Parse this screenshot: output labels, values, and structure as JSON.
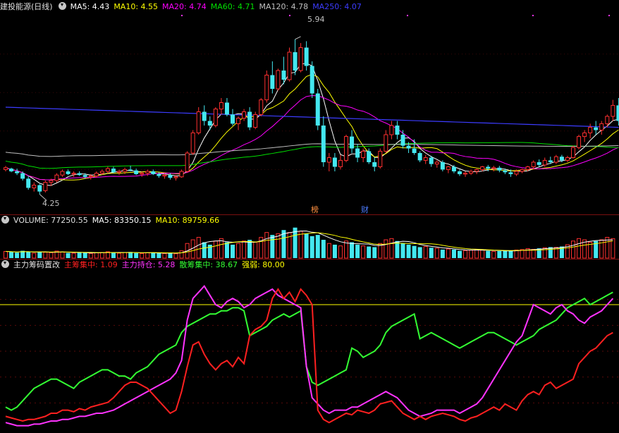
{
  "main": {
    "title": "建投能源(日线)",
    "indicators": [
      {
        "label": "MA5: 4.43",
        "color": "#ffffff"
      },
      {
        "label": "MA10: 4.55",
        "color": "#ffff00"
      },
      {
        "label": "MA20: 4.74",
        "color": "#ff00ff"
      },
      {
        "label": "MA60: 4.71",
        "color": "#00e000"
      },
      {
        "label": "MA120: 4.78",
        "color": "#c0c0c0"
      },
      {
        "label": "MA250: 4.07",
        "color": "#3c3cff"
      }
    ],
    "high_label": "5.94",
    "low_label": "4.25",
    "markers": [
      "榜",
      "财"
    ]
  },
  "volume": {
    "title": "VOLUME: 77250.55",
    "ma5": "MA5: 83350.15",
    "ma10": "MA10: 89759.66"
  },
  "indicator": {
    "title": "主力筹码置改",
    "items": [
      {
        "label": "主筹集中: 1.09",
        "color": "#ff2020"
      },
      {
        "label": "主力持仓: 5.28",
        "color": "#ff33ff"
      },
      {
        "label": "散筹集中: 38.67",
        "color": "#33ff33"
      },
      {
        "label": "强弱: 80.00",
        "color": "#ffff00"
      }
    ]
  },
  "colors": {
    "up": "#ff3030",
    "down": "#44e8f0",
    "bg": "#000000",
    "grid": "#7a1010"
  },
  "chart_data": [
    {
      "type": "candlestick",
      "ylim": [
        4.1,
        6.2
      ],
      "annotations": {
        "high": 5.94,
        "low": 4.25
      },
      "ohlc": [
        [
          4.52,
          4.56,
          4.5,
          4.54
        ],
        [
          4.53,
          4.54,
          4.49,
          4.5
        ],
        [
          4.5,
          4.53,
          4.46,
          4.48
        ],
        [
          4.48,
          4.5,
          4.4,
          4.42
        ],
        [
          4.42,
          4.45,
          4.3,
          4.32
        ],
        [
          4.32,
          4.38,
          4.28,
          4.35
        ],
        [
          4.35,
          4.36,
          4.25,
          4.28
        ],
        [
          4.29,
          4.4,
          4.27,
          4.38
        ],
        [
          4.38,
          4.42,
          4.34,
          4.4
        ],
        [
          4.4,
          4.48,
          4.38,
          4.46
        ],
        [
          4.46,
          4.52,
          4.44,
          4.5
        ],
        [
          4.5,
          4.52,
          4.46,
          4.47
        ],
        [
          4.47,
          4.5,
          4.44,
          4.48
        ],
        [
          4.48,
          4.5,
          4.45,
          4.46
        ],
        [
          4.46,
          4.48,
          4.42,
          4.44
        ],
        [
          4.44,
          4.47,
          4.41,
          4.45
        ],
        [
          4.45,
          4.5,
          4.43,
          4.48
        ],
        [
          4.48,
          4.52,
          4.46,
          4.5
        ],
        [
          4.5,
          4.55,
          4.48,
          4.53
        ],
        [
          4.53,
          4.55,
          4.48,
          4.49
        ],
        [
          4.49,
          4.52,
          4.46,
          4.5
        ],
        [
          4.5,
          4.54,
          4.47,
          4.52
        ],
        [
          4.52,
          4.56,
          4.5,
          4.51
        ],
        [
          4.51,
          4.53,
          4.46,
          4.47
        ],
        [
          4.47,
          4.5,
          4.44,
          4.48
        ],
        [
          4.48,
          4.52,
          4.45,
          4.5
        ],
        [
          4.5,
          4.52,
          4.46,
          4.47
        ],
        [
          4.47,
          4.49,
          4.43,
          4.45
        ],
        [
          4.45,
          4.48,
          4.42,
          4.46
        ],
        [
          4.46,
          4.48,
          4.41,
          4.43
        ],
        [
          4.43,
          4.46,
          4.4,
          4.44
        ],
        [
          4.44,
          4.52,
          4.43,
          4.5
        ],
        [
          4.5,
          4.72,
          4.49,
          4.7
        ],
        [
          4.7,
          4.95,
          4.68,
          4.92
        ],
        [
          4.92,
          5.2,
          4.9,
          5.15
        ],
        [
          5.15,
          5.22,
          5.0,
          5.05
        ],
        [
          5.05,
          5.1,
          4.95,
          5.0
        ],
        [
          5.0,
          5.2,
          4.98,
          5.18
        ],
        [
          5.18,
          5.3,
          5.12,
          5.25
        ],
        [
          5.25,
          5.3,
          5.1,
          5.12
        ],
        [
          5.12,
          5.18,
          5.0,
          5.02
        ],
        [
          5.02,
          5.1,
          4.95,
          5.08
        ],
        [
          5.08,
          5.18,
          5.05,
          5.15
        ],
        [
          5.15,
          5.2,
          4.95,
          4.98
        ],
        [
          4.98,
          5.15,
          4.96,
          5.12
        ],
        [
          5.12,
          5.3,
          5.1,
          5.28
        ],
        [
          5.28,
          5.6,
          5.25,
          5.55
        ],
        [
          5.55,
          5.7,
          5.35,
          5.4
        ],
        [
          5.4,
          5.62,
          5.38,
          5.6
        ],
        [
          5.6,
          5.75,
          5.45,
          5.5
        ],
        [
          5.5,
          5.85,
          5.48,
          5.8
        ],
        [
          5.8,
          5.94,
          5.55,
          5.6
        ],
        [
          5.6,
          5.9,
          5.58,
          5.85
        ],
        [
          5.85,
          5.92,
          5.6,
          5.65
        ],
        [
          5.65,
          5.7,
          5.3,
          5.35
        ],
        [
          5.35,
          5.4,
          4.95,
          5.0
        ],
        [
          5.0,
          5.1,
          4.55,
          4.6
        ],
        [
          4.6,
          4.7,
          4.5,
          4.65
        ],
        [
          4.65,
          4.7,
          4.5,
          4.55
        ],
        [
          4.55,
          4.68,
          4.52,
          4.62
        ],
        [
          4.62,
          4.9,
          4.6,
          4.88
        ],
        [
          4.88,
          4.95,
          4.7,
          4.75
        ],
        [
          4.75,
          4.8,
          4.6,
          4.65
        ],
        [
          4.65,
          4.75,
          4.6,
          4.72
        ],
        [
          4.72,
          4.75,
          4.58,
          4.6
        ],
        [
          4.6,
          4.65,
          4.5,
          4.55
        ],
        [
          4.55,
          4.75,
          4.53,
          4.72
        ],
        [
          4.72,
          4.95,
          4.7,
          4.9
        ],
        [
          4.9,
          5.05,
          4.85,
          5.0
        ],
        [
          5.0,
          5.05,
          4.85,
          4.9
        ],
        [
          4.9,
          4.95,
          4.75,
          4.78
        ],
        [
          4.78,
          4.82,
          4.7,
          4.75
        ],
        [
          4.75,
          4.85,
          4.68,
          4.7
        ],
        [
          4.7,
          4.72,
          4.6,
          4.62
        ],
        [
          4.62,
          4.68,
          4.58,
          4.65
        ],
        [
          4.65,
          4.67,
          4.55,
          4.58
        ],
        [
          4.58,
          4.62,
          4.54,
          4.6
        ],
        [
          4.6,
          4.62,
          4.5,
          4.52
        ],
        [
          4.52,
          4.56,
          4.48,
          4.55
        ],
        [
          4.55,
          4.57,
          4.48,
          4.5
        ],
        [
          4.5,
          4.52,
          4.45,
          4.47
        ],
        [
          4.47,
          4.5,
          4.44,
          4.48
        ],
        [
          4.48,
          4.52,
          4.46,
          4.5
        ],
        [
          4.5,
          4.53,
          4.47,
          4.52
        ],
        [
          4.52,
          4.56,
          4.5,
          4.55
        ],
        [
          4.55,
          4.57,
          4.5,
          4.53
        ],
        [
          4.53,
          4.56,
          4.5,
          4.54
        ],
        [
          4.54,
          4.56,
          4.49,
          4.51
        ],
        [
          4.51,
          4.53,
          4.47,
          4.49
        ],
        [
          4.49,
          4.52,
          4.44,
          4.47
        ],
        [
          4.47,
          4.52,
          4.45,
          4.5
        ],
        [
          4.5,
          4.53,
          4.48,
          4.52
        ],
        [
          4.52,
          4.56,
          4.5,
          4.55
        ],
        [
          4.55,
          4.62,
          4.52,
          4.6
        ],
        [
          4.6,
          4.63,
          4.55,
          4.57
        ],
        [
          4.57,
          4.65,
          4.55,
          4.62
        ],
        [
          4.62,
          4.66,
          4.58,
          4.6
        ],
        [
          4.6,
          4.68,
          4.58,
          4.66
        ],
        [
          4.66,
          4.68,
          4.6,
          4.62
        ],
        [
          4.62,
          4.67,
          4.6,
          4.65
        ],
        [
          4.65,
          4.78,
          4.64,
          4.76
        ],
        [
          4.76,
          4.9,
          4.74,
          4.88
        ],
        [
          4.88,
          4.95,
          4.82,
          4.92
        ],
        [
          4.92,
          5.02,
          4.86,
          4.98
        ],
        [
          4.98,
          5.05,
          4.9,
          4.95
        ],
        [
          4.95,
          5.05,
          4.9,
          5.02
        ],
        [
          5.02,
          5.12,
          4.98,
          5.1
        ],
        [
          5.1,
          5.28,
          5.05,
          5.22
        ],
        [
          5.22,
          5.3,
          5.0,
          5.05
        ]
      ]
    },
    {
      "type": "bar",
      "title": "VOLUME",
      "values": [
        55,
        50,
        45,
        60,
        55,
        40,
        52,
        48,
        45,
        58,
        50,
        42,
        40,
        45,
        48,
        38,
        44,
        46,
        52,
        48,
        40,
        46,
        50,
        42,
        38,
        44,
        46,
        40,
        38,
        42,
        36,
        60,
        120,
        150,
        170,
        130,
        110,
        140,
        160,
        130,
        110,
        120,
        140,
        150,
        130,
        170,
        210,
        190,
        200,
        230,
        210,
        250,
        220,
        200,
        180,
        190,
        150,
        120,
        110,
        100,
        140,
        130,
        110,
        100,
        95,
        90,
        120,
        150,
        160,
        140,
        120,
        110,
        100,
        90,
        95,
        85,
        80,
        70,
        75,
        70,
        60,
        62,
        65,
        70,
        68,
        60,
        55,
        58,
        60,
        62,
        66,
        70,
        78,
        72,
        80,
        85,
        90,
        88,
        95,
        110,
        140,
        160,
        150,
        130,
        140,
        150,
        170,
        160
      ]
    },
    {
      "type": "line",
      "title": "主力筹码置改",
      "ylim": [
        0,
        100
      ],
      "series": [
        {
          "name": "主筹集中",
          "values": [
            8,
            7,
            6,
            5,
            6,
            6,
            7,
            8,
            10,
            10,
            12,
            12,
            11,
            13,
            12,
            14,
            15,
            16,
            17,
            20,
            24,
            28,
            30,
            30,
            28,
            26,
            22,
            18,
            14,
            10,
            12,
            24,
            40,
            54,
            56,
            48,
            42,
            38,
            42,
            44,
            40,
            46,
            42,
            60,
            64,
            66,
            70,
            84,
            90,
            84,
            88,
            82,
            90,
            86,
            80,
            12,
            6,
            4,
            6,
            8,
            10,
            9,
            12,
            11,
            10,
            12,
            16,
            17,
            18,
            14,
            10,
            8,
            6,
            8,
            6,
            8,
            9,
            10,
            9,
            8,
            6,
            5,
            7,
            8,
            10,
            12,
            14,
            12,
            16,
            14,
            12,
            18,
            22,
            24,
            22,
            28,
            30,
            26,
            28,
            30,
            32,
            42,
            46,
            50,
            52,
            56,
            60,
            62
          ]
        },
        {
          "name": "主力持仓",
          "values": [
            4,
            3,
            2,
            2,
            2,
            3,
            3,
            4,
            5,
            5,
            6,
            6,
            7,
            8,
            8,
            9,
            10,
            10,
            11,
            12,
            14,
            16,
            18,
            20,
            22,
            24,
            26,
            28,
            30,
            32,
            36,
            44,
            70,
            84,
            88,
            92,
            86,
            80,
            78,
            82,
            84,
            82,
            78,
            80,
            84,
            86,
            88,
            90,
            86,
            84,
            82,
            80,
            78,
            40,
            20,
            16,
            12,
            10,
            12,
            12,
            12,
            14,
            14,
            16,
            18,
            20,
            22,
            24,
            22,
            20,
            16,
            12,
            10,
            8,
            9,
            10,
            12,
            12,
            12,
            12,
            10,
            12,
            14,
            16,
            20,
            26,
            32,
            38,
            44,
            50,
            56,
            60,
            70,
            80,
            78,
            76,
            74,
            78,
            80,
            76,
            74,
            70,
            68,
            72,
            74,
            76,
            80,
            84
          ]
        },
        {
          "name": "散筹集中",
          "values": [
            14,
            12,
            14,
            18,
            22,
            26,
            28,
            30,
            32,
            32,
            30,
            28,
            26,
            30,
            32,
            34,
            36,
            38,
            38,
            36,
            34,
            34,
            32,
            36,
            38,
            40,
            44,
            48,
            50,
            52,
            54,
            62,
            66,
            68,
            70,
            72,
            74,
            74,
            76,
            76,
            78,
            78,
            76,
            60,
            62,
            64,
            66,
            70,
            72,
            74,
            72,
            74,
            76,
            40,
            30,
            28,
            30,
            32,
            34,
            36,
            38,
            52,
            50,
            46,
            48,
            50,
            54,
            62,
            66,
            68,
            70,
            72,
            74,
            58,
            60,
            62,
            60,
            58,
            56,
            54,
            52,
            54,
            56,
            58,
            60,
            62,
            62,
            60,
            58,
            56,
            54,
            56,
            58,
            60,
            64,
            66,
            68,
            70,
            74,
            78,
            80,
            82,
            84,
            80,
            82,
            84,
            86,
            88
          ]
        },
        {
          "name": "强弱",
          "values": [
            80
          ]
        }
      ]
    }
  ]
}
